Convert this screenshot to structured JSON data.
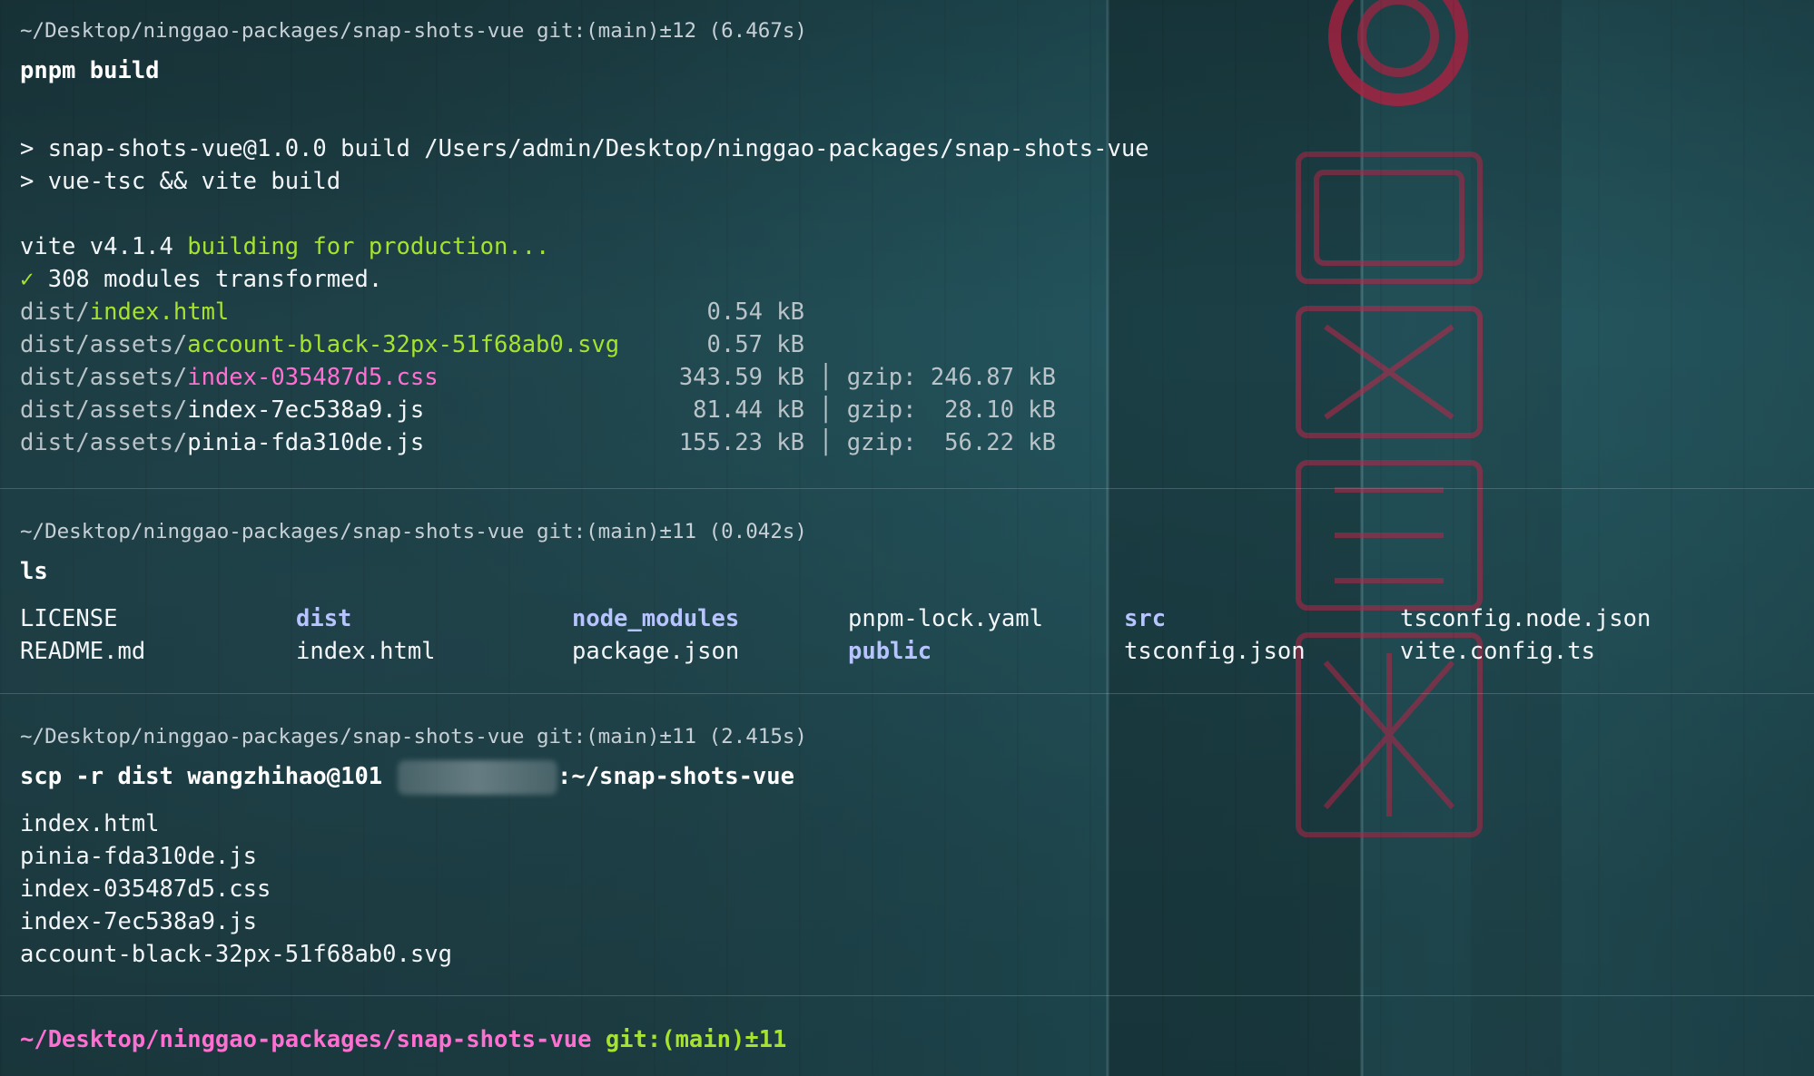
{
  "terminal": {
    "block1": {
      "prompt": "~/Desktop/ninggao-packages/snap-shots-vue git:(main)±12 (6.467s)",
      "command": "pnpm build",
      "lines": [
        "> snap-shots-vue@1.0.0 build /Users/admin/Desktop/ninggao-packages/snap-shots-vue",
        "> vue-tsc && vite build"
      ],
      "vite_prefix": "vite v4.1.4",
      "vite_text": "building for production...",
      "check_mark": "✓",
      "modules_text": "308 modules transformed.",
      "files": [
        {
          "dir": "dist/",
          "name": "index.html",
          "size": "0.54 kB",
          "gzip": ""
        },
        {
          "dir": "dist/assets/",
          "name": "account-black-32px-51f68ab0.svg",
          "size": "0.57 kB",
          "gzip": ""
        },
        {
          "dir": "dist/assets/",
          "name": "index-035487d5.css",
          "size": "343.59 kB",
          "gzip": "│ gzip: 246.87 kB"
        },
        {
          "dir": "dist/assets/",
          "name": "index-7ec538a9.js",
          "size": "81.44 kB",
          "gzip": "│ gzip:  28.10 kB"
        },
        {
          "dir": "dist/assets/",
          "name": "pinia-fda310de.js",
          "size": "155.23 kB",
          "gzip": "│ gzip:  56.22 kB"
        }
      ]
    },
    "block2": {
      "prompt": "~/Desktop/ninggao-packages/snap-shots-vue git:(main)±11 (0.042s)",
      "command": "ls",
      "entries": [
        {
          "name": "LICENSE",
          "type": "file"
        },
        {
          "name": "README.md",
          "type": "file"
        },
        {
          "name": "dist",
          "type": "dir"
        },
        {
          "name": "index.html",
          "type": "file"
        },
        {
          "name": "node_modules",
          "type": "dir"
        },
        {
          "name": "package.json",
          "type": "file"
        },
        {
          "name": "pnpm-lock.yaml",
          "type": "file"
        },
        {
          "name": "public",
          "type": "dir"
        },
        {
          "name": "src",
          "type": "dir"
        },
        {
          "name": "tsconfig.json",
          "type": "file"
        },
        {
          "name": "tsconfig.node.json",
          "type": "file"
        },
        {
          "name": "vite.config.ts",
          "type": "file"
        }
      ]
    },
    "block3": {
      "prompt": "~/Desktop/ninggao-packages/snap-shots-vue git:(main)±11 (2.415s)",
      "command_prefix": "scp -r dist wangzhihao@101",
      "command_suffix": ":~/snap-shots-vue",
      "output": [
        "index.html",
        "pinia-fda310de.js",
        "index-035487d5.css",
        "index-7ec538a9.js",
        "account-black-32px-51f68ab0.svg"
      ]
    },
    "current_prompt": {
      "path": "~/Desktop/ninggao-packages/snap-shots-vue",
      "git": "git:(main)±11"
    }
  },
  "colors": {
    "prompt_path": "#ff6fd1",
    "git_status": "#a6e22e",
    "directory": "#b7c4ff",
    "css_file": "#ff6fd1",
    "html_file": "#a6e22e"
  }
}
